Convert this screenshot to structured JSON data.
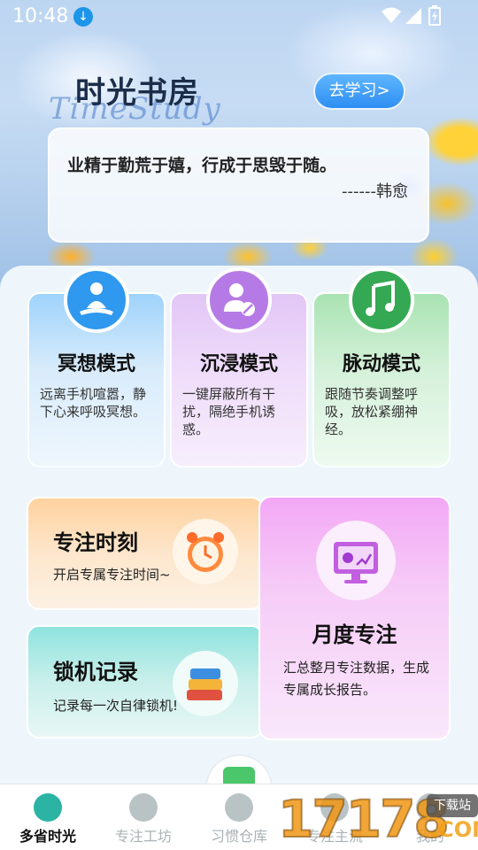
{
  "status_bar": {
    "time": "10:48"
  },
  "header": {
    "title": "时光书房",
    "script_title": "TimeStudy",
    "study_button": "去学习>"
  },
  "quote": {
    "text": "业精于勤荒于嬉，行成于思毁于随。",
    "author": "------韩愈"
  },
  "modes": [
    {
      "title": "冥想模式",
      "desc": "远离手机喧嚣，静下心来呼吸冥想。",
      "icon": "meditation-icon",
      "color": "#2f98ef"
    },
    {
      "title": "沉浸模式",
      "desc": "一键屏蔽所有干扰，隔绝手机诱惑。",
      "icon": "user-block-icon",
      "color": "#b67ae6"
    },
    {
      "title": "脉动模式",
      "desc": "跟随节奏调整呼吸，放松紧绷神经。",
      "icon": "music-note-icon",
      "color": "#34a853"
    }
  ],
  "focus_card": {
    "title": "专注时刻",
    "sub": "开启专属专注时间~"
  },
  "lock_card": {
    "title": "锁机记录",
    "sub": "记录每一次自律锁机!"
  },
  "month_card": {
    "title": "月度专注",
    "sub": "汇总整月专注数据，生成专属成长报告。"
  },
  "tabs": [
    {
      "label": "多省时光",
      "active": true,
      "icon": "bear-icon"
    },
    {
      "label": "专注工坊",
      "active": false,
      "icon": "bulb-icon"
    },
    {
      "label": "习惯仓库",
      "active": false,
      "icon": "box-icon"
    },
    {
      "label": "专注主流",
      "active": false,
      "icon": "clock-icon"
    },
    {
      "label": "我的",
      "active": false,
      "icon": "user-icon"
    }
  ],
  "watermark": {
    "number": "17178",
    "com": ".COM",
    "tag": "下载站"
  }
}
